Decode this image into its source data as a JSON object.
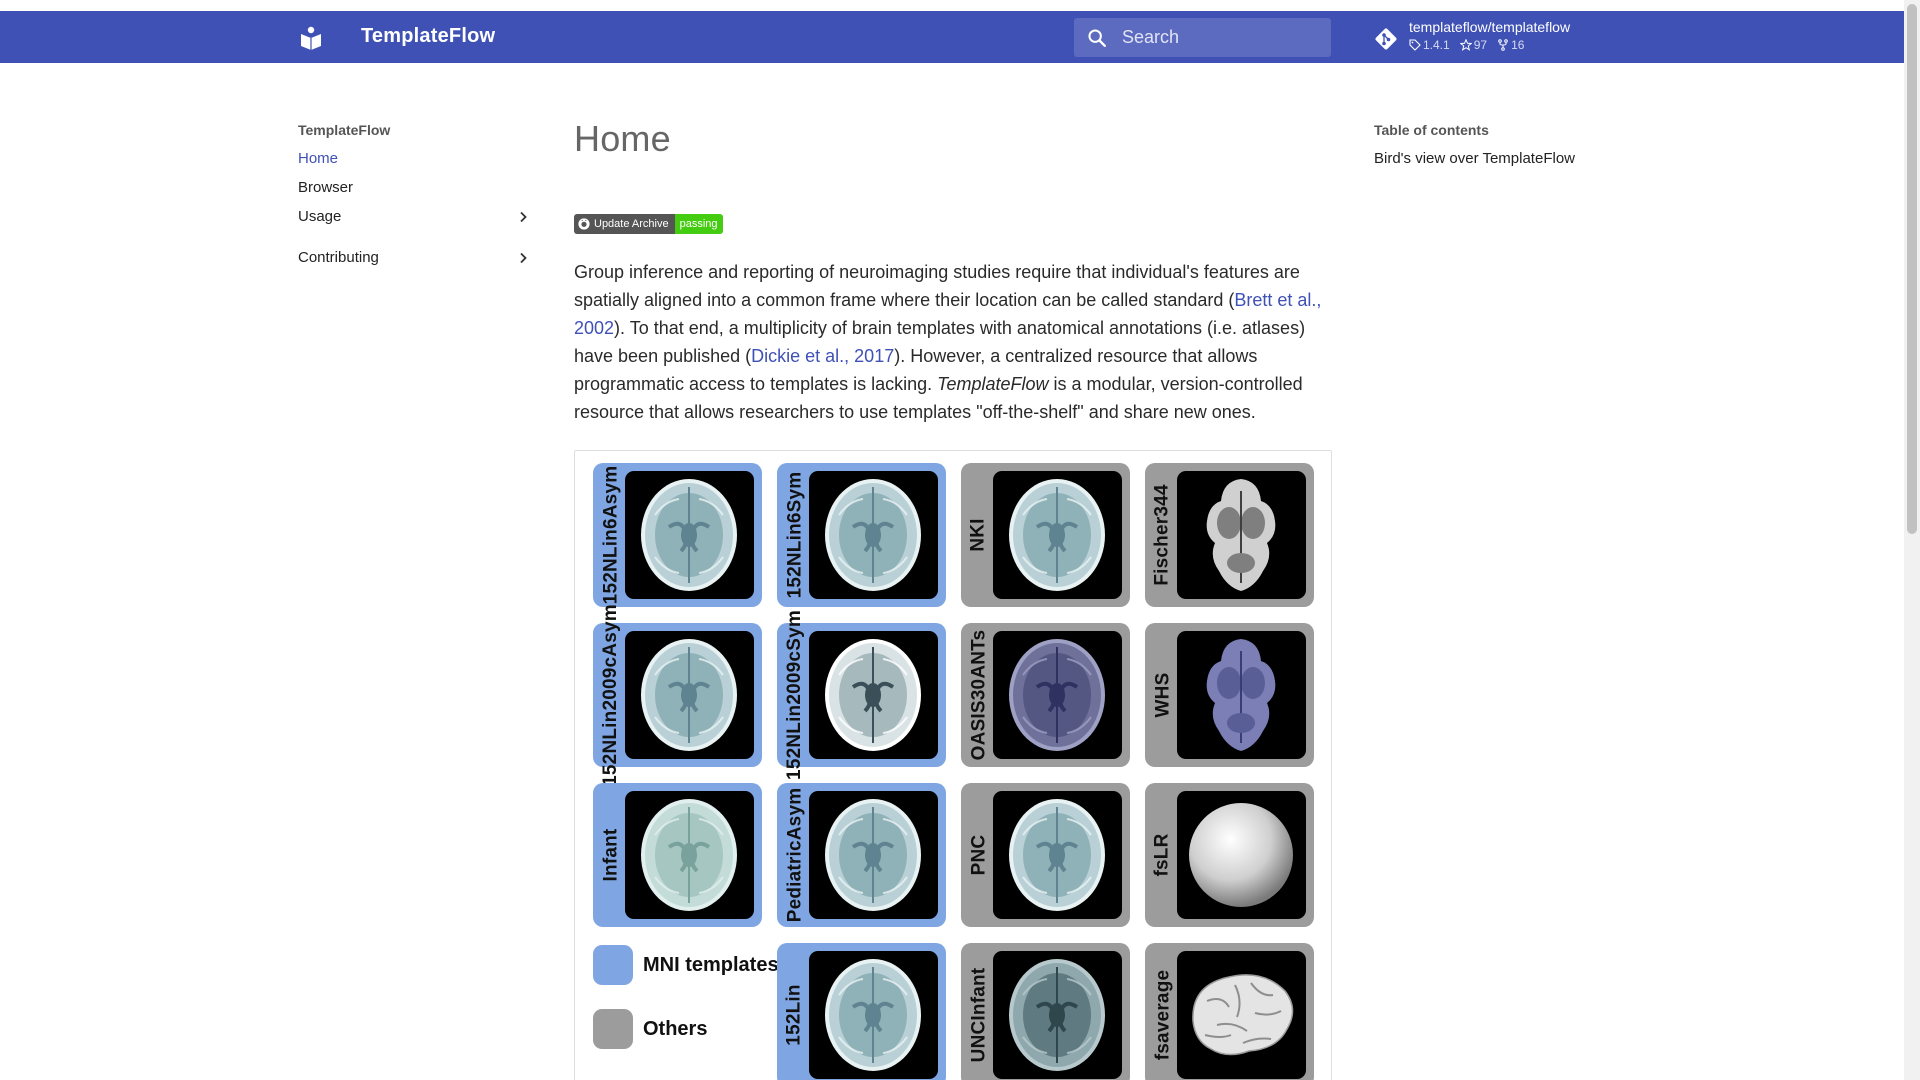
{
  "header": {
    "site_title": "TemplateFlow",
    "search_placeholder": "Search",
    "repo": {
      "name": "templateflow/templateflow",
      "version": "1.4.1",
      "stars": "97",
      "forks": "16"
    },
    "color": "#3f51b5"
  },
  "nav": {
    "title": "TemplateFlow",
    "items": [
      {
        "label": "Home",
        "active": true
      },
      {
        "label": "Browser"
      },
      {
        "label": "Usage",
        "expandable": true
      },
      {
        "label": "Contributing",
        "expandable": true
      }
    ]
  },
  "toc": {
    "title": "Table of contents",
    "items": [
      "Bird's view over TemplateFlow"
    ]
  },
  "main": {
    "title": "Home",
    "badge": {
      "left": "Update Archive",
      "right": "passing"
    },
    "intro": {
      "p1": "Group inference and reporting of neuroimaging studies require that individual's features are spatially aligned into a common frame where their location can be called standard (",
      "link1": "Brett et al., 2002",
      "p2": "). To that end, a multiplicity of brain templates with anatomical annotations (i.e. atlases) have been published (",
      "link2": "Dickie et al., 2017",
      "p3": "). However, a centralized resource that allows programmatic access to templates is lacking. ",
      "em": "TemplateFlow",
      "p4": " is a modular, version-controlled resource that allows researchers to use templates \"off-the-shelf\" and share new ones."
    },
    "figure": {
      "tiles": [
        {
          "label": "152NLin6Asym",
          "group": "mni",
          "image": "brain-axial-light"
        },
        {
          "label": "152NLin6Sym",
          "group": "mni",
          "image": "brain-axial-light"
        },
        {
          "label": "NKI",
          "group": "other",
          "image": "brain-axial-light"
        },
        {
          "label": "Fischer344",
          "group": "other",
          "image": "rat-brain"
        },
        {
          "label": "152NLin2009cAsym",
          "group": "mni",
          "image": "brain-axial-light"
        },
        {
          "label": "152NLin2009cSym",
          "group": "mni",
          "image": "brain-axial-contrast"
        },
        {
          "label": "OASIS30ANTs",
          "group": "other",
          "image": "brain-axial-purple"
        },
        {
          "label": "WHS",
          "group": "other",
          "image": "rat-brain-purple"
        },
        {
          "label": "Infant",
          "group": "mni",
          "image": "brain-axial-infant"
        },
        {
          "label": "PediatricAsym",
          "group": "mni",
          "image": "brain-axial-light"
        },
        {
          "label": "PNC",
          "group": "other",
          "image": "brain-axial-light"
        },
        {
          "label": "fsLR",
          "group": "other",
          "image": "sphere"
        },
        {
          "label": "152Lin",
          "group": "mni",
          "image": "brain-axial-light"
        },
        {
          "label": "UNCInfant",
          "group": "other",
          "image": "brain-axial-dark"
        },
        {
          "label": "fsaverage",
          "group": "other",
          "image": "brain-surface"
        }
      ],
      "legend": [
        {
          "label": "MNI templates",
          "group": "mni"
        },
        {
          "label": "Others",
          "group": "other"
        }
      ],
      "colors": {
        "mni": "#7fa6e3",
        "other": "#9c9c9c"
      }
    }
  }
}
